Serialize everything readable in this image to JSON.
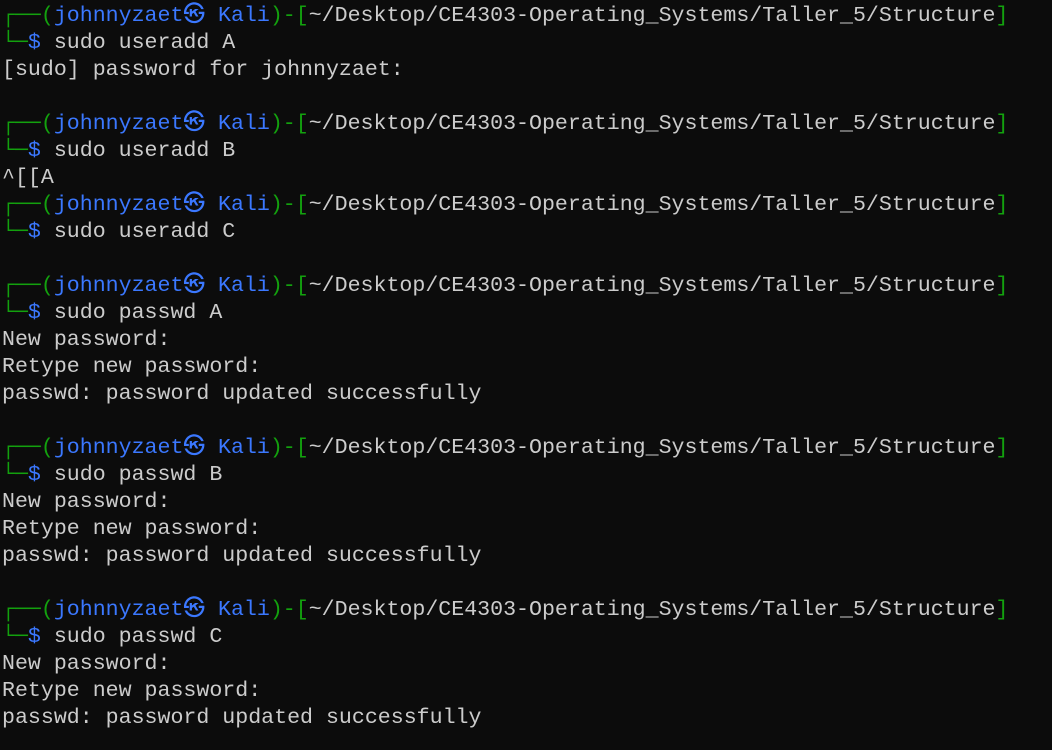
{
  "colors": {
    "background": "#0c0c0c",
    "text": "#cccccc",
    "frame": "#13a10e",
    "user": "#3b78ff"
  },
  "prompt": {
    "top_left": "┌──(",
    "user": "johnnyzaet㉿ Kali",
    "mid": ")-[",
    "path": "~/Desktop/CE4303-Operating_Systems/Taller_5/Structure",
    "close": "]",
    "bottom_left": "└─",
    "dollar": "$"
  },
  "lines": [
    {
      "type": "prompt"
    },
    {
      "type": "cmd",
      "text": " sudo useradd A"
    },
    {
      "type": "out",
      "text": "[sudo] password for johnnyzaet:"
    },
    {
      "type": "out",
      "text": ""
    },
    {
      "type": "prompt"
    },
    {
      "type": "cmd",
      "text": " sudo useradd B"
    },
    {
      "type": "out",
      "text": "^[[A"
    },
    {
      "type": "prompt"
    },
    {
      "type": "cmd",
      "text": " sudo useradd C"
    },
    {
      "type": "out",
      "text": ""
    },
    {
      "type": "prompt"
    },
    {
      "type": "cmd",
      "text": " sudo passwd A"
    },
    {
      "type": "out",
      "text": "New password:"
    },
    {
      "type": "out",
      "text": "Retype new password:"
    },
    {
      "type": "out",
      "text": "passwd: password updated successfully"
    },
    {
      "type": "out",
      "text": ""
    },
    {
      "type": "prompt"
    },
    {
      "type": "cmd",
      "text": " sudo passwd B"
    },
    {
      "type": "out",
      "text": "New password:"
    },
    {
      "type": "out",
      "text": "Retype new password:"
    },
    {
      "type": "out",
      "text": "passwd: password updated successfully"
    },
    {
      "type": "out",
      "text": ""
    },
    {
      "type": "prompt"
    },
    {
      "type": "cmd",
      "text": " sudo passwd C"
    },
    {
      "type": "out",
      "text": "New password:"
    },
    {
      "type": "out",
      "text": "Retype new password:"
    },
    {
      "type": "out",
      "text": "passwd: password updated successfully"
    }
  ]
}
